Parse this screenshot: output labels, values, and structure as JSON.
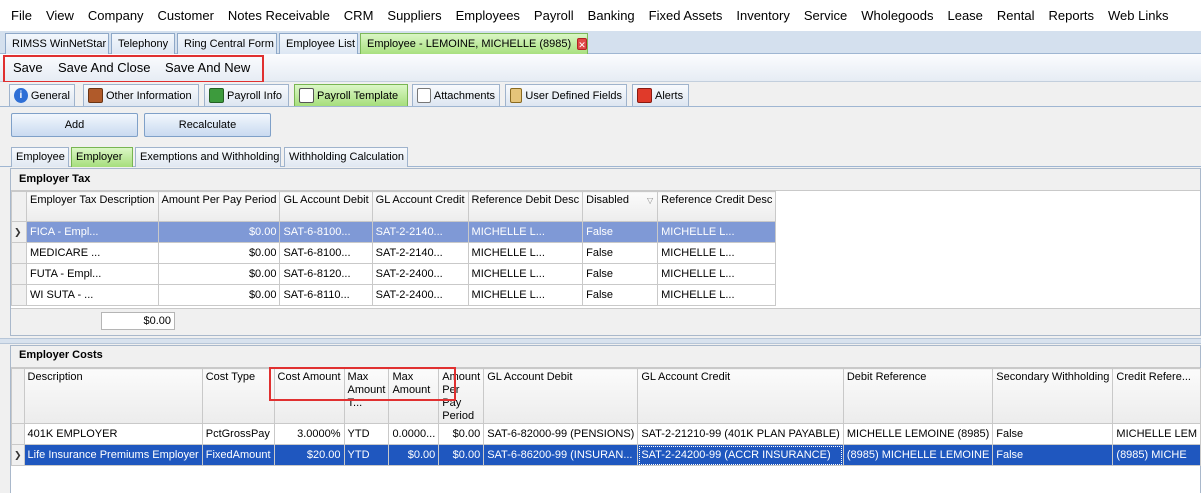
{
  "menu": [
    "File",
    "View",
    "Company",
    "Customer",
    "Notes Receivable",
    "CRM",
    "Suppliers",
    "Employees",
    "Payroll",
    "Banking",
    "Fixed Assets",
    "Inventory",
    "Service",
    "Wholegoods",
    "Lease",
    "Rental",
    "Reports",
    "Web Links"
  ],
  "doc_tabs": [
    "RIMSS WinNetStar",
    "Telephony",
    "Ring Central Form",
    "Employee List",
    "Employee - LEMOINE, MICHELLE (8985)"
  ],
  "toolbar": {
    "save": "Save",
    "save_close": "Save And Close",
    "save_new": "Save And New"
  },
  "section_tabs": [
    "General",
    "Other Information",
    "Payroll Info",
    "Payroll Template",
    "Attachments",
    "User Defined Fields",
    "Alerts"
  ],
  "actions": {
    "add": "Add",
    "recalculate": "Recalculate"
  },
  "sub_tabs": [
    "Employee",
    "Employer",
    "Exemptions and Withholding",
    "Withholding Calculation"
  ],
  "employer_tax": {
    "title": "Employer Tax",
    "headers": [
      "Employer Tax Description",
      "Amount Per Pay Period",
      "GL Account Debit",
      "GL Account Credit",
      "Reference Debit Desc",
      "Disabled",
      "Reference Credit Desc"
    ],
    "rows": [
      [
        "FICA - Empl...",
        "$0.00",
        "SAT-6-8100...",
        "SAT-2-2140...",
        "MICHELLE L...",
        "False",
        "MICHELLE L..."
      ],
      [
        "MEDICARE ...",
        "$0.00",
        "SAT-6-8100...",
        "SAT-2-2140...",
        "MICHELLE L...",
        "False",
        "MICHELLE L..."
      ],
      [
        "FUTA - Empl...",
        "$0.00",
        "SAT-6-8120...",
        "SAT-2-2400...",
        "MICHELLE L...",
        "False",
        "MICHELLE L..."
      ],
      [
        "WI SUTA - ...",
        "$0.00",
        "SAT-6-8110...",
        "SAT-2-2400...",
        "MICHELLE L...",
        "False",
        "MICHELLE L..."
      ]
    ],
    "total": "$0.00"
  },
  "employer_costs": {
    "title": "Employer Costs",
    "headers": [
      "Description",
      "Cost Type",
      "Cost Amount",
      "Max Amount T...",
      "Max Amount",
      "Amount Per Pay Period",
      "GL Account Debit",
      "GL Account Credit",
      "Debit Reference",
      "Secondary Withholding",
      "Credit Refere..."
    ],
    "rows": [
      [
        "401K EMPLOYER",
        "PctGrossPay",
        "3.0000%",
        "YTD",
        "0.0000...",
        "$0.00",
        "SAT-6-82000-99 (PENSIONS)",
        "SAT-2-21210-99 (401K PLAN PAYABLE)",
        "MICHELLE LEMOINE (8985)",
        "False",
        "MICHELLE LEM"
      ],
      [
        "Life Insurance Premiums Employer",
        "FixedAmount",
        "$20.00",
        "YTD",
        "$0.00",
        "$0.00",
        "SAT-6-86200-99 (INSURAN...",
        "SAT-2-24200-99 (ACCR INSURANCE)",
        "(8985) MICHELLE LEMOINE",
        "False",
        "(8985) MICHE"
      ]
    ]
  }
}
